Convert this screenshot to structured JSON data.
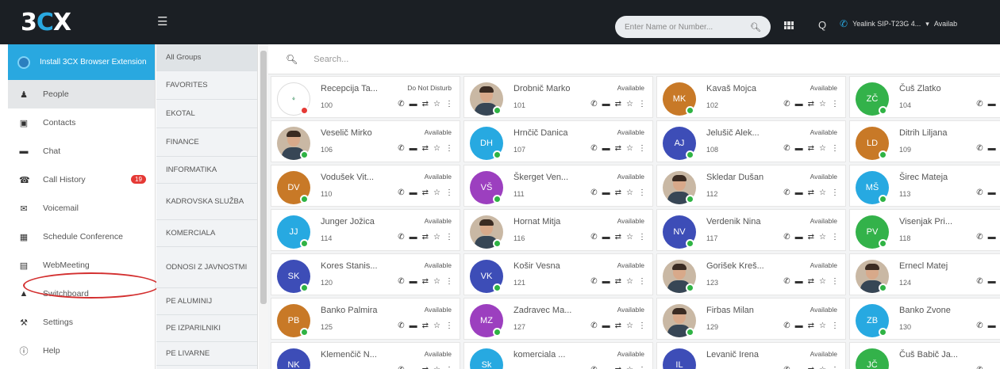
{
  "topbar": {
    "logo": "3CX",
    "search_placeholder": "Enter Name or Number...",
    "phone_label": "Yealink SIP-T23G 4...",
    "availability": "Availab"
  },
  "sidebar": {
    "install": "Install 3CX Browser Extension",
    "items": [
      {
        "label": "People",
        "icon": "person-icon"
      },
      {
        "label": "Contacts",
        "icon": "contacts-icon"
      },
      {
        "label": "Chat",
        "icon": "chat-icon"
      },
      {
        "label": "Call History",
        "icon": "phone-icon",
        "badge": "19"
      },
      {
        "label": "Voicemail",
        "icon": "voicemail-icon"
      },
      {
        "label": "Schedule Conference",
        "icon": "calendar-icon"
      },
      {
        "label": "WebMeeting",
        "icon": "webmeeting-icon"
      },
      {
        "label": "Switchboard",
        "icon": "switchboard-icon"
      },
      {
        "label": "Settings",
        "icon": "wrench-icon"
      },
      {
        "label": "Help",
        "icon": "help-icon"
      }
    ]
  },
  "groups": [
    "All Groups",
    "FAVORITES",
    "EKOTAL",
    "FINANCE",
    "INFORMATIKA",
    "KADROVSKA SLUŽBA",
    "KOMERCIALA",
    "ODNOSI Z JAVNOSTMI",
    "PE ALUMINIJ",
    "PE IZPARILNIKI",
    "PE LIVARNE"
  ],
  "search": {
    "placeholder": "Search..."
  },
  "colors": {
    "accent": "#29a8e0",
    "available": "#2fb344",
    "dnd": "#e53935",
    "highlight": "#d32f2f"
  },
  "contacts": [
    {
      "name": "Recepcija Ta...",
      "status": "Do Not Disturb",
      "ext": "100",
      "avatar": "logo",
      "color": "#ffffff",
      "dot": "#e53935"
    },
    {
      "name": "Drobnič Marko",
      "status": "Available",
      "ext": "101",
      "avatar": "photo",
      "color": "",
      "dot": "#2fb344"
    },
    {
      "name": "Kavaš Mojca",
      "status": "Available",
      "ext": "102",
      "avatar": "MK",
      "color": "#c87927",
      "dot": "#2fb344"
    },
    {
      "name": "Čuš Zlatko",
      "status": "",
      "ext": "104",
      "avatar": "ZČ",
      "color": "#33b24a",
      "dot": "#2fb344"
    },
    {
      "name": "Veselič Mirko",
      "status": "Available",
      "ext": "106",
      "avatar": "photo",
      "color": "",
      "dot": "#2fb344"
    },
    {
      "name": "Hrnčič Danica",
      "status": "Available",
      "ext": "107",
      "avatar": "DH",
      "color": "#27a9e1",
      "dot": "#2fb344"
    },
    {
      "name": "Jelušič Alek...",
      "status": "Available",
      "ext": "108",
      "avatar": "AJ",
      "color": "#3d4db7",
      "dot": "#2fb344"
    },
    {
      "name": "Ditrih Liljana",
      "status": "",
      "ext": "109",
      "avatar": "LD",
      "color": "#c87927",
      "dot": "#2fb344"
    },
    {
      "name": "Vodušek Vit...",
      "status": "Available",
      "ext": "110",
      "avatar": "DV",
      "color": "#c87927",
      "dot": "#2fb344"
    },
    {
      "name": "Škerget Ven...",
      "status": "Available",
      "ext": "111",
      "avatar": "VŠ",
      "color": "#9c3fbf",
      "dot": "#2fb344"
    },
    {
      "name": "Skledar Dušan",
      "status": "Available",
      "ext": "112",
      "avatar": "photo",
      "color": "",
      "dot": "#2fb344"
    },
    {
      "name": "Širec Mateja",
      "status": "",
      "ext": "113",
      "avatar": "MŠ",
      "color": "#27a9e1",
      "dot": "#2fb344"
    },
    {
      "name": "Junger Jožica",
      "status": "Available",
      "ext": "114",
      "avatar": "JJ",
      "color": "#27a9e1",
      "dot": "#2fb344"
    },
    {
      "name": "Hornat Mitja",
      "status": "Available",
      "ext": "116",
      "avatar": "photo",
      "color": "",
      "dot": "#2fb344"
    },
    {
      "name": "Verdenik Nina",
      "status": "Available",
      "ext": "117",
      "avatar": "NV",
      "color": "#3d4db7",
      "dot": "#2fb344"
    },
    {
      "name": "Visenjak Pri...",
      "status": "",
      "ext": "118",
      "avatar": "PV",
      "color": "#33b24a",
      "dot": "#2fb344"
    },
    {
      "name": "Kores Stanis...",
      "status": "Available",
      "ext": "120",
      "avatar": "SK",
      "color": "#3d4db7",
      "dot": "#2fb344"
    },
    {
      "name": "Košir Vesna",
      "status": "Available",
      "ext": "121",
      "avatar": "VK",
      "color": "#3d4db7",
      "dot": "#2fb344"
    },
    {
      "name": "Gorišek Kreš...",
      "status": "Available",
      "ext": "123",
      "avatar": "photo",
      "color": "",
      "dot": "#2fb344"
    },
    {
      "name": "Ernecl Matej",
      "status": "",
      "ext": "124",
      "avatar": "photo",
      "color": "",
      "dot": "#2fb344"
    },
    {
      "name": "Banko Palmira",
      "status": "Available",
      "ext": "125",
      "avatar": "PB",
      "color": "#c87927",
      "dot": "#2fb344"
    },
    {
      "name": "Zadravec Ma...",
      "status": "Available",
      "ext": "127",
      "avatar": "MZ",
      "color": "#9c3fbf",
      "dot": "#2fb344"
    },
    {
      "name": "Firbas Milan",
      "status": "Available",
      "ext": "129",
      "avatar": "photo",
      "color": "",
      "dot": "#2fb344"
    },
    {
      "name": "Banko Zvone",
      "status": "",
      "ext": "130",
      "avatar": "ZB",
      "color": "#27a9e1",
      "dot": "#2fb344"
    },
    {
      "name": "Klemenčič N...",
      "status": "Available",
      "ext": "",
      "avatar": "NK",
      "color": "#3d4db7",
      "dot": "#2fb344"
    },
    {
      "name": "komerciala ...",
      "status": "Available",
      "ext": "",
      "avatar": "Sk",
      "color": "#27a9e1",
      "dot": "#2fb344"
    },
    {
      "name": "Levanič Irena",
      "status": "Available",
      "ext": "",
      "avatar": "IL",
      "color": "#3d4db7",
      "dot": "#2fb344"
    },
    {
      "name": "Čuš Babič Ja...",
      "status": "",
      "ext": "",
      "avatar": "JČ",
      "color": "#33b24a",
      "dot": "#2fb344"
    }
  ]
}
